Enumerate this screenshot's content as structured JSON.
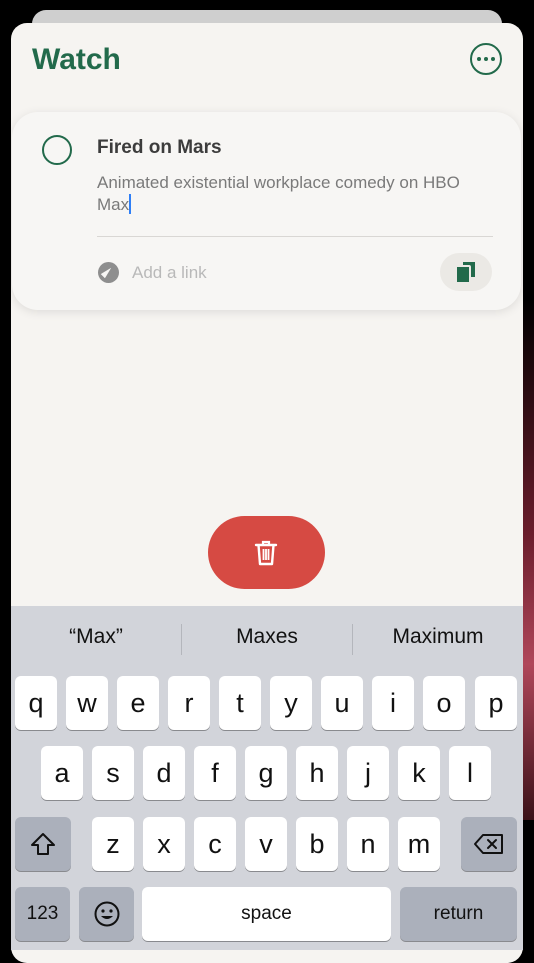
{
  "sheet": {
    "title": "Watch"
  },
  "item": {
    "title": "Fired on Mars",
    "note": "Animated existential workplace comedy on HBO Max",
    "link_placeholder": "Add a link"
  },
  "keyboard": {
    "suggestions": [
      "“Max”",
      "Maxes",
      "Maximum"
    ],
    "row1": [
      "q",
      "w",
      "e",
      "r",
      "t",
      "y",
      "u",
      "i",
      "o",
      "p"
    ],
    "row2": [
      "a",
      "s",
      "d",
      "f",
      "g",
      "h",
      "j",
      "k",
      "l"
    ],
    "row3": [
      "z",
      "x",
      "c",
      "v",
      "b",
      "n",
      "m"
    ],
    "numbers_label": "123",
    "space_label": "space",
    "return_label": "return"
  },
  "colors": {
    "accent": "#226a4b",
    "delete": "#d64a43",
    "caret": "#2f7ff6"
  }
}
